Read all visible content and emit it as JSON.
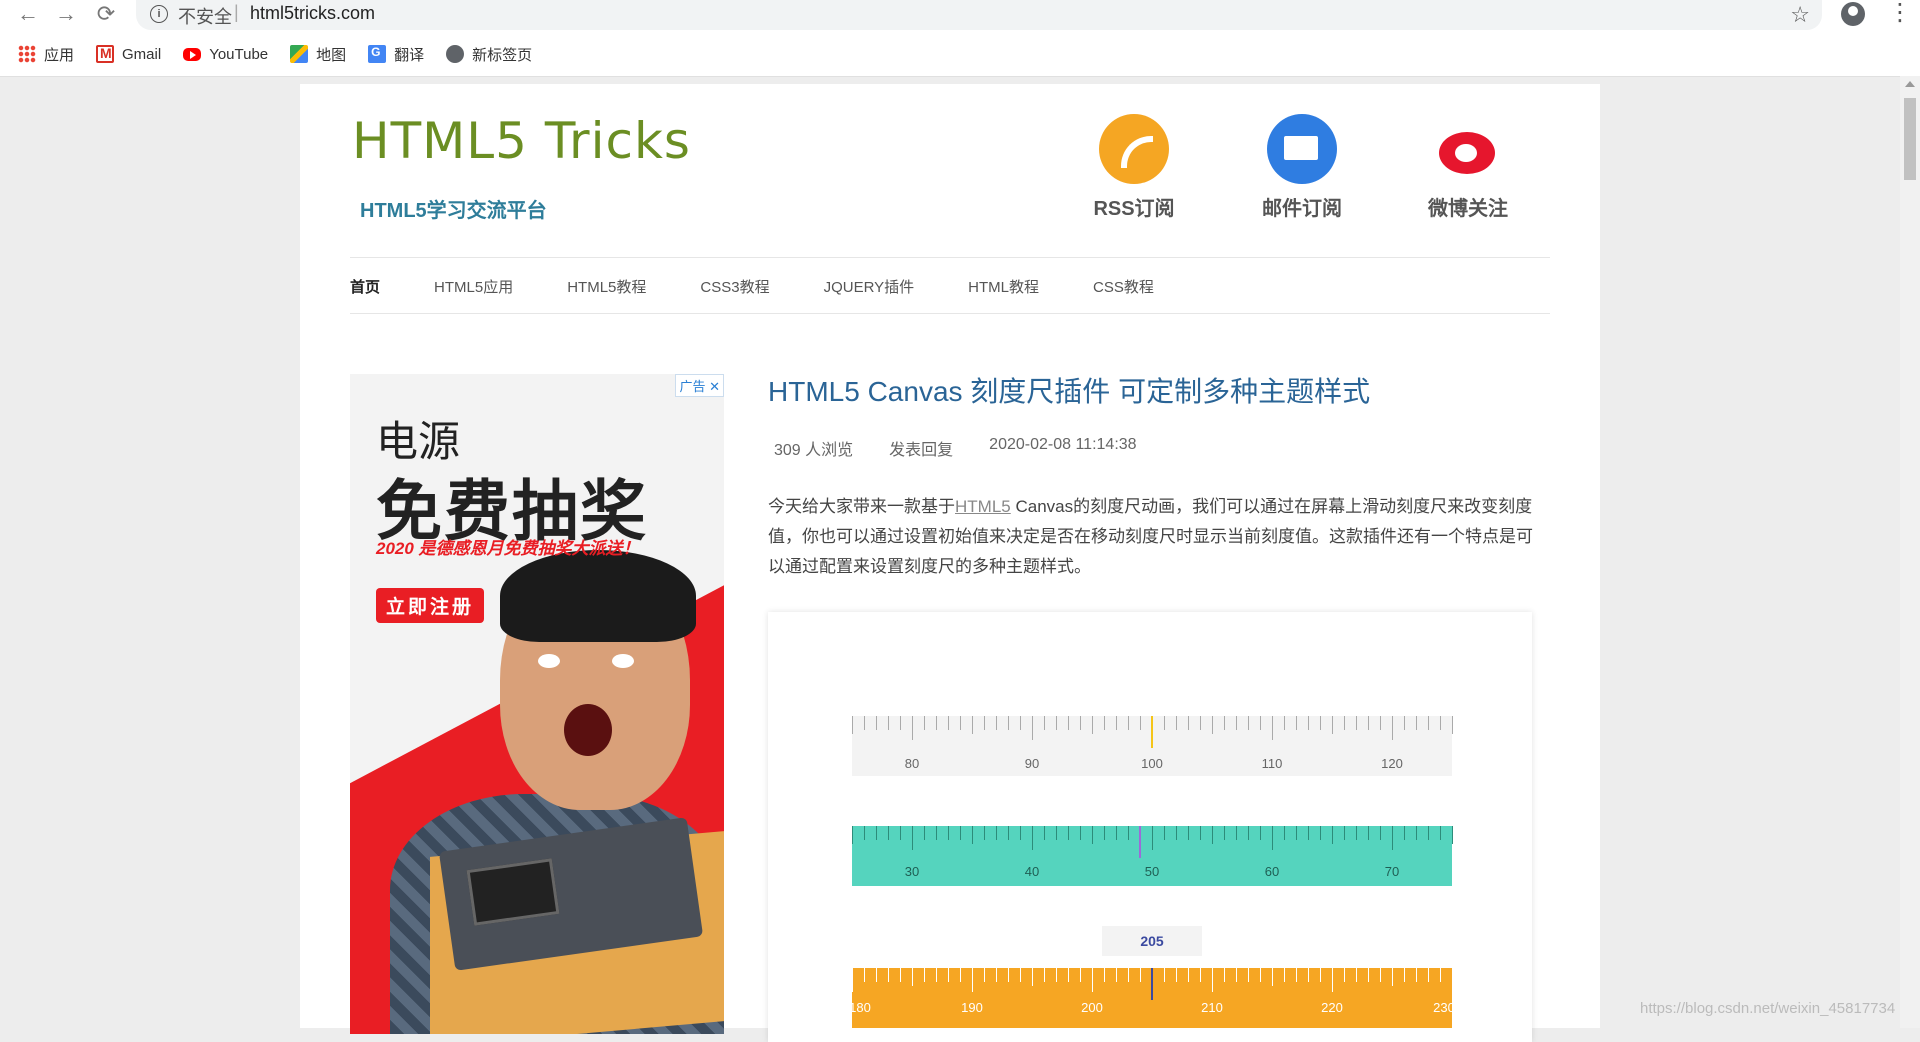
{
  "browser": {
    "insecure_label": "不安全",
    "url": "html5tricks.com",
    "bookmarks": [
      "应用",
      "Gmail",
      "YouTube",
      "地图",
      "翻译",
      "新标签页"
    ]
  },
  "site": {
    "logo": "HTML5 Tricks",
    "tagline": "HTML5学习交流平台",
    "social": [
      {
        "label": "RSS订阅",
        "icon": "rss-icon"
      },
      {
        "label": "邮件订阅",
        "icon": "mail-icon"
      },
      {
        "label": "微博关注",
        "icon": "weibo-icon"
      }
    ],
    "nav": [
      "首页",
      "HTML5应用",
      "HTML5教程",
      "CSS3教程",
      "JQUERY插件",
      "HTML教程",
      "CSS教程"
    ]
  },
  "ad": {
    "tag": "广告",
    "line1": "电源",
    "line2": "免费抽奖",
    "line3": "2020 是德感恩月免费抽奖大派送！",
    "button": "立即注册"
  },
  "article": {
    "title": "HTML5 Canvas 刻度尺插件 可定制多种主题样式",
    "views": "309 人浏览",
    "reply": "发表回复",
    "date": "2020-02-08 11:14:38",
    "intro_before": "今天给大家带来一款基于",
    "intro_link": "HTML5",
    "intro_after": " Canvas的刻度尺动画，我们可以通过在屏幕上滑动刻度尺来改变刻度值，你也可以通过设置初始值来决定是否在移动刻度尺时显示当前刻度值。这款插件还有一个特点是可以通过配置来设置刻度尺的多种主题样式。"
  },
  "rulers": [
    {
      "labels": [
        80,
        90,
        100,
        110,
        120
      ],
      "start": 75,
      "end": 125,
      "value": 100,
      "pointer_color": "#f5c518"
    },
    {
      "labels": [
        30,
        40,
        50,
        60,
        70
      ],
      "start": 25,
      "end": 75,
      "value": 49,
      "pointer_color": "#9b6bd8"
    },
    {
      "labels": [
        180,
        190,
        200,
        210,
        220,
        230
      ],
      "start": 180,
      "end": 230,
      "value": 205,
      "pointer_color": "#3b4aa0",
      "display": "205"
    }
  ],
  "watermark": "https://blog.csdn.net/weixin_45817734"
}
